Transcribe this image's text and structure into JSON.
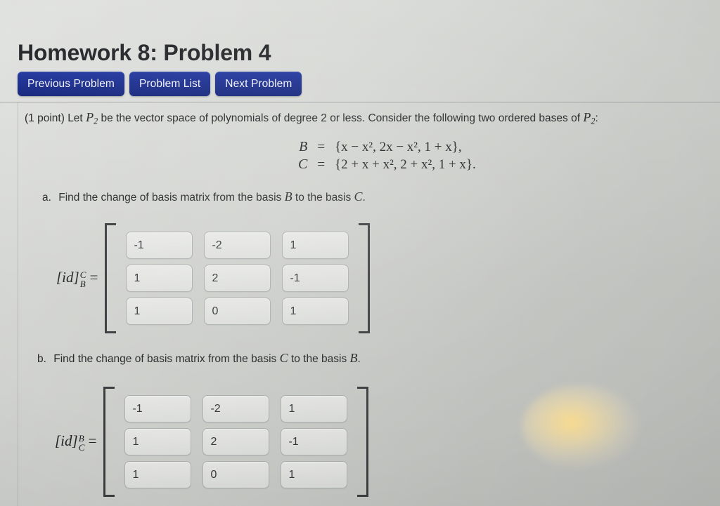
{
  "page": {
    "title": "Homework 8: Problem 4",
    "background_color": "#c9cbc8"
  },
  "navbar": {
    "buttons": [
      {
        "label": "Previous Problem",
        "name": "previous-problem-button"
      },
      {
        "label": "Problem List",
        "name": "problem-list-button"
      },
      {
        "label": "Next Problem",
        "name": "next-problem-button"
      }
    ],
    "color": "#1c2f8e"
  },
  "statement": {
    "points": "(1 point)",
    "text_before": "Let",
    "space_symbol": "P",
    "space_subscript": "2",
    "text_middle": "be the vector space of polynomials of degree 2 or less. Consider the following two ordered bases of",
    "space_symbol_2": "P",
    "space_subscript_2": "2",
    "text_after": ":"
  },
  "bases": [
    {
      "name": "B",
      "eq": "=",
      "set": "{x − x², 2x − x², 1 + x},",
      "terms": [
        "x − x²",
        "2x − x²",
        "1 + x"
      ]
    },
    {
      "name": "C",
      "eq": "=",
      "set": "{2 + x + x², 2 + x², 1 + x}.",
      "terms": [
        "2 + x + x²",
        "2 + x²",
        "1 + x"
      ]
    }
  ],
  "parts": [
    {
      "marker": "a.",
      "question": "Find the change of basis matrix from the basis B to the basis C.",
      "question_pre": "Find the change of basis matrix from the basis",
      "from_basis": "B",
      "question_mid": "to the basis",
      "to_basis": "C",
      "question_end": ".",
      "matrix_label_base": "[id]",
      "matrix_label_sup": "C",
      "matrix_label_sub": "B",
      "matrix_label_eq": "=",
      "matrix": [
        [
          "-1",
          "-2",
          "1"
        ],
        [
          "1",
          "2",
          "-1"
        ],
        [
          "1",
          "0",
          "1"
        ]
      ]
    },
    {
      "marker": "b.",
      "question": "Find the change of basis matrix from the basis C to the basis B.",
      "question_pre": "Find the change of basis matrix from the basis",
      "from_basis": "C",
      "question_mid": "to the basis",
      "to_basis": "B",
      "question_end": ".",
      "matrix_label_base": "[id]",
      "matrix_label_sup": "B",
      "matrix_label_sub": "C",
      "matrix_label_eq": "=",
      "matrix": [
        [
          "-1",
          "-2",
          "1"
        ],
        [
          "1",
          "2",
          "-1"
        ],
        [
          "1",
          "0",
          "1"
        ]
      ]
    }
  ]
}
